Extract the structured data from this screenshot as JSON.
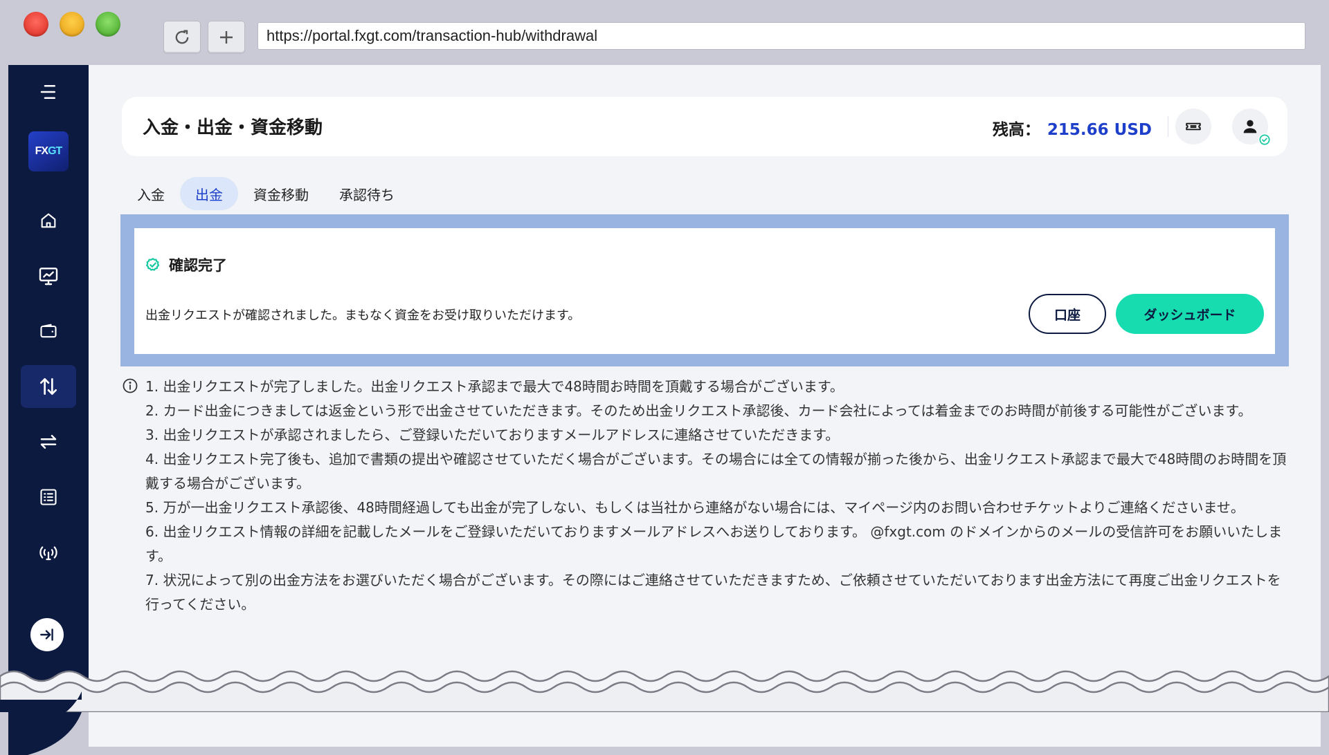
{
  "browser": {
    "url": "https://portal.fxgt.com/transaction-hub/withdrawal"
  },
  "sidebar": {
    "logo": {
      "fx": "FX",
      "gt": "GT"
    },
    "items": [
      {
        "icon": "home-icon"
      },
      {
        "icon": "chart-monitor-icon"
      },
      {
        "icon": "wallet-icon"
      },
      {
        "icon": "transfer-updown-icon",
        "active": true
      },
      {
        "icon": "exchange-arrows-icon"
      },
      {
        "icon": "list-icon"
      },
      {
        "icon": "signal-icon"
      }
    ]
  },
  "header": {
    "title": "入金・出金・資金移動",
    "balance_label": "残高：",
    "balance_value": "215.66 USD"
  },
  "tabs": [
    {
      "label": "入金"
    },
    {
      "label": "出金",
      "active": true
    },
    {
      "label": "資金移動"
    },
    {
      "label": "承認待ち"
    }
  ],
  "confirmation": {
    "title": "確認完了",
    "message": "出金リクエストが確認されました。まもなく資金をお受け取りいただけます。",
    "account_button": "口座",
    "dashboard_button": "ダッシュボード"
  },
  "notes": [
    "1. 出金リクエストが完了しました。出金リクエスト承認まで最大で48時間お時間を頂戴する場合がございます。",
    "2. カード出金につきましては返金という形で出金させていただきます。そのため出金リクエスト承認後、カード会社によっては着金までのお時間が前後する可能性がございます。",
    "3. 出金リクエストが承認されましたら、ご登録いただいておりますメールアドレスに連絡させていただきます。",
    "4. 出金リクエスト完了後も、追加で書類の提出や確認させていただく場合がございます。その場合には全ての情報が揃った後から、出金リクエスト承認まで最大で48時間のお時間を頂戴する場合がございます。",
    "5. 万が一出金リクエスト承認後、48時間経過しても出金が完了しない、もしくは当社から連絡がない場合には、マイページ内のお問い合わせチケットよりご連絡くださいませ。",
    "6. 出金リクエスト情報の詳細を記載したメールをご登録いただいておりますメールアドレスへお送りしております。 @fxgt.com のドメインからのメールの受信許可をお願いいたします。",
    "7. 状況によって別の出金方法をお選びいただく場合がございます。その際にはご連絡させていただきますため、ご依頼させていただいております出金方法にて再度ご出金リクエストを行ってください。"
  ],
  "colors": {
    "sidebar_bg": "#0c1a40",
    "accent_blue": "#1e3fc9",
    "accent_green": "#16dcb0",
    "confirm_frame": "#9ab4e2"
  }
}
